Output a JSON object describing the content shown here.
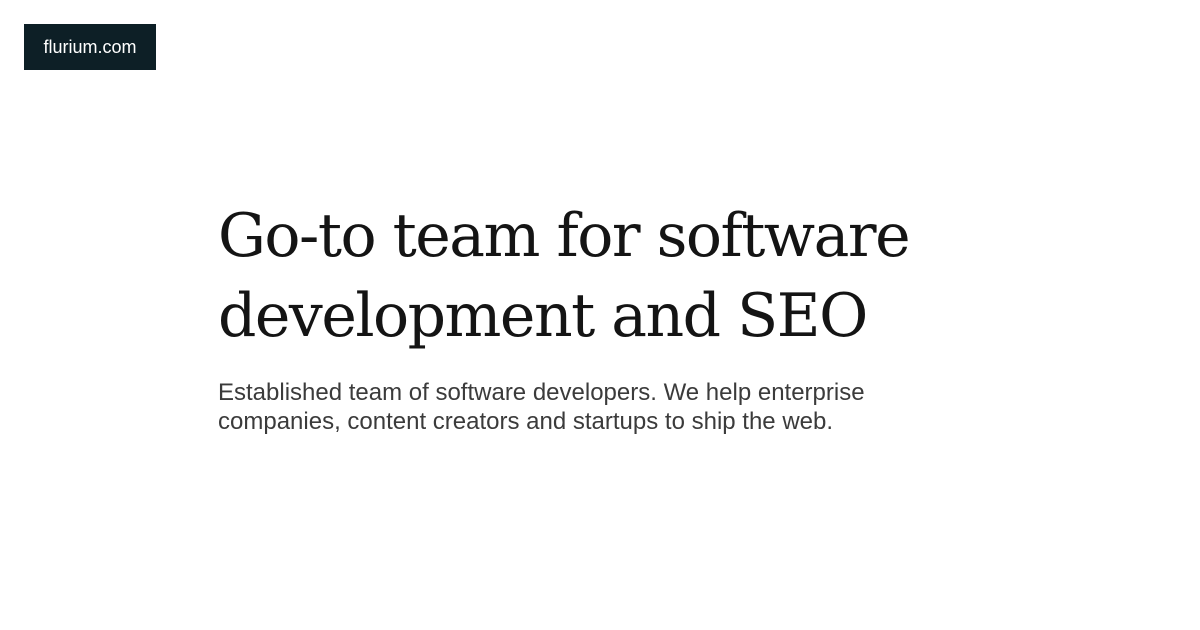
{
  "brand": {
    "label": "flurium.com",
    "background_color": "#0d1f26",
    "text_color": "#ffffff"
  },
  "hero": {
    "title": "Go-to team for software development and SEO",
    "subtitle": "Established team of software developers. We help enterprise companies, content creators and startups to ship the web."
  }
}
